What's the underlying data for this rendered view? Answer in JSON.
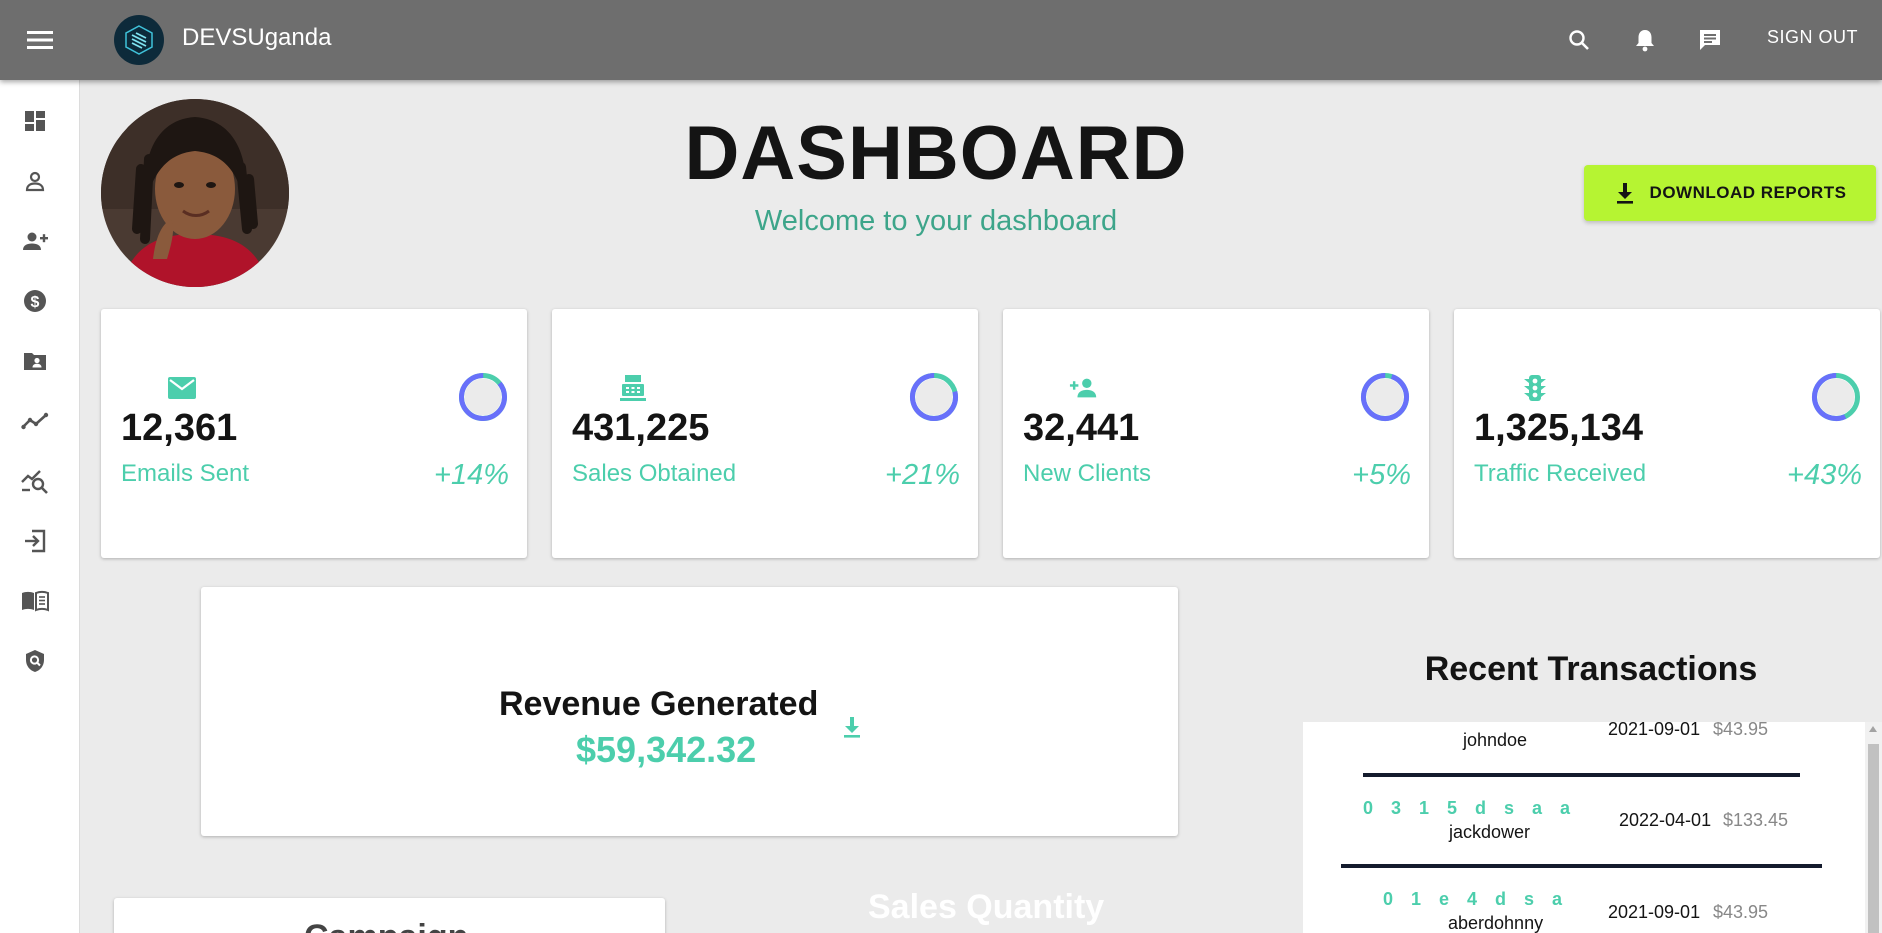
{
  "topbar": {
    "brand": "DEVSUganda",
    "sign_out": "SIGN OUT",
    "icons": [
      "menu-icon",
      "search-icon",
      "bell-icon",
      "message-icon"
    ]
  },
  "sidebar": {
    "items": [
      {
        "icon": "dashboard-icon"
      },
      {
        "icon": "person-icon"
      },
      {
        "icon": "person-add-icon"
      },
      {
        "icon": "dollar-icon"
      },
      {
        "icon": "contacts-folder-icon"
      },
      {
        "icon": "trending-icon"
      },
      {
        "icon": "chart-search-icon"
      },
      {
        "icon": "login-icon"
      },
      {
        "icon": "book-icon"
      },
      {
        "icon": "security-icon"
      }
    ]
  },
  "header": {
    "title": "DASHBOARD",
    "subtitle": "Welcome to your dashboard",
    "download_label": "DOWNLOAD REPORTS"
  },
  "stats": [
    {
      "value": "12,361",
      "label": "Emails Sent",
      "percent": "+14%",
      "progress": 0.14,
      "icon": "email-icon"
    },
    {
      "value": "431,225",
      "label": "Sales Obtained",
      "percent": "+21%",
      "progress": 0.21,
      "icon": "point-of-sale-icon"
    },
    {
      "value": "32,441",
      "label": "New Clients",
      "percent": "+5%",
      "progress": 0.05,
      "icon": "person-add-icon"
    },
    {
      "value": "1,325,134",
      "label": "Traffic Received",
      "percent": "+43%",
      "progress": 0.43,
      "icon": "traffic-icon"
    }
  ],
  "revenue": {
    "title": "Revenue Generated",
    "value": "$59,342.32"
  },
  "transactions": {
    "title": "Recent Transactions",
    "rows": [
      {
        "txid": "",
        "user": "johndoe",
        "date": "2021-09-01",
        "cost": "$43.95"
      },
      {
        "txid": "0315dsaa",
        "user": "jackdower",
        "date": "2022-04-01",
        "cost": "$133.45"
      },
      {
        "txid": "01e4dsa",
        "user": "aberdohnny",
        "date": "2021-09-01",
        "cost": "$43.95"
      }
    ]
  },
  "bottom": {
    "campaign_title": "Campaign",
    "sales_quantity_title": "Sales Quantity"
  },
  "colors": {
    "topbar": "#6e6e6e",
    "accent_green": "#4cceac",
    "subtitle_green": "#3da58a",
    "download_button": "#b6f432",
    "ring_blue": "#6870fa"
  }
}
